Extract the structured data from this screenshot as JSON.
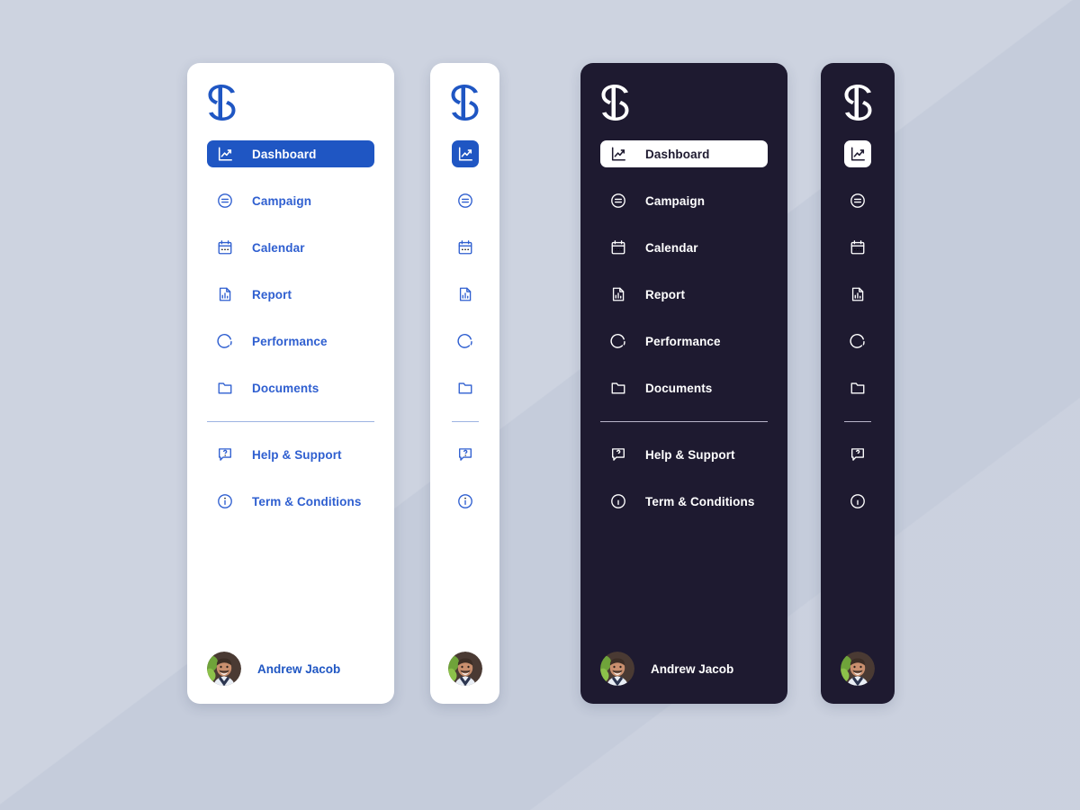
{
  "theme": {
    "page_background": "#c5ccdb",
    "accent_blue": "#1f56c3",
    "label_blue": "#2f5fd0",
    "dark_panel": "#1e1a30",
    "white": "#ffffff"
  },
  "brand": {
    "logo_name": "striped-s-logo",
    "logo_letter": "S"
  },
  "nav": {
    "items": [
      {
        "label": "Dashboard",
        "icon": "chart-line-icon",
        "active": true
      },
      {
        "label": "Campaign",
        "icon": "equals-circle-icon",
        "active": false
      },
      {
        "label": "Calendar",
        "icon": "calendar-icon",
        "active": false
      },
      {
        "label": "Report",
        "icon": "report-doc-icon",
        "active": false
      },
      {
        "label": "Performance",
        "icon": "progress-ring-icon",
        "active": false
      },
      {
        "label": "Documents",
        "icon": "folder-icon",
        "active": false
      }
    ],
    "secondary_items": [
      {
        "label": "Help & Support",
        "icon": "chat-question-icon",
        "active": false
      },
      {
        "label": "Term & Conditions",
        "icon": "info-circle-icon",
        "active": false
      }
    ]
  },
  "user": {
    "name": "Andrew Jacob",
    "avatar_name": "user-avatar-photo"
  },
  "panels": [
    {
      "id": "light-expanded",
      "theme": "light",
      "mode": "expanded"
    },
    {
      "id": "light-collapsed",
      "theme": "light",
      "mode": "collapsed"
    },
    {
      "id": "dark-expanded",
      "theme": "dark",
      "mode": "expanded"
    },
    {
      "id": "dark-collapsed",
      "theme": "dark",
      "mode": "collapsed"
    }
  ]
}
